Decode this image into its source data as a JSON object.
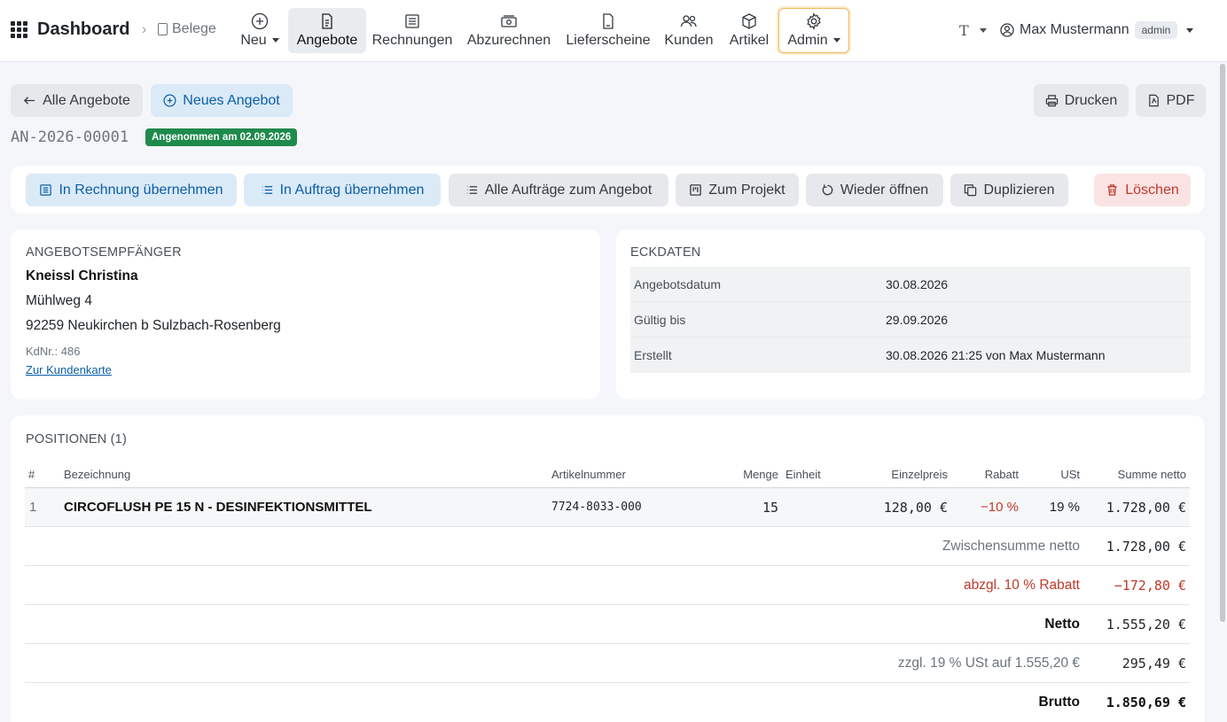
{
  "navbar": {
    "brand": "Dashboard",
    "breadcrumb": "Belege",
    "items": [
      {
        "label": "Neu",
        "icon": "plus-circle-icon"
      },
      {
        "label": "Angebote",
        "icon": "document-icon"
      },
      {
        "label": "Rechnungen",
        "icon": "receipt-icon"
      },
      {
        "label": "Abzurechnen",
        "icon": "cash-icon"
      },
      {
        "label": "Lieferscheine",
        "icon": "file-icon"
      },
      {
        "label": "Kunden",
        "icon": "people-icon"
      },
      {
        "label": "Artikel",
        "icon": "box-icon"
      },
      {
        "label": "Admin",
        "icon": "gear-icon"
      }
    ],
    "theme_label": "T",
    "user_name": "Max Mustermann",
    "user_role": "admin"
  },
  "toolbar": {
    "back_label": "Alle Angebote",
    "new_label": "Neues Angebot",
    "print_label": "Drucken",
    "pdf_label": "PDF"
  },
  "document": {
    "number": "AN-2026-00001",
    "status": "Angenommen am 02.09.2026"
  },
  "actions": {
    "to_invoice": "In Rechnung übernehmen",
    "to_order": "In Auftrag übernehmen",
    "all_orders": "Alle Aufträge zum Angebot",
    "to_project": "Zum Projekt",
    "reopen": "Wieder öffnen",
    "duplicate": "Duplizieren",
    "delete": "Löschen"
  },
  "recipient": {
    "title": "Angebotsempfänger",
    "name": "Kneissl Christina",
    "street": "Mühlweg 4",
    "city": "92259 Neukirchen b Sulzbach-Rosenberg",
    "customer_no": "KdNr.: 486",
    "link": "Zur Kundenkarte"
  },
  "key_data": {
    "title": "Eckdaten",
    "rows": [
      {
        "key": "Angebotsdatum",
        "value": "30.08.2026"
      },
      {
        "key": "Gültig bis",
        "value": "29.09.2026"
      },
      {
        "key": "Erstellt",
        "value": "30.08.2026 21:25 von Max Mustermann"
      }
    ]
  },
  "positions": {
    "title": "Positionen (1)",
    "headers": {
      "num": "#",
      "desc": "Bezeichnung",
      "sku": "Artikelnummer",
      "qty": "Menge",
      "unit": "Einheit",
      "price": "Einzelpreis",
      "discount": "Rabatt",
      "vat": "USt",
      "sum": "Summe netto"
    },
    "rows": [
      {
        "num": "1",
        "desc": "CIRCOFLUSH PE 15 N - DESINFEKTIONSMITTEL",
        "sku": "7724-8033-000",
        "qty": "15",
        "unit": "",
        "price": "128,00 €",
        "discount": "−10 %",
        "vat": "19 %",
        "sum": "1.728,00 €"
      }
    ],
    "totals": {
      "subtotal_label": "Zwischensumme netto",
      "subtotal_value": "1.728,00 €",
      "discount_label": "abzgl. 10 % Rabatt",
      "discount_value": "−172,80 €",
      "net_label": "Netto",
      "net_value": "1.555,20 €",
      "vat_label": "zzgl. 19 % USt auf 1.555,20 €",
      "vat_value": "295,49 €",
      "gross_label": "Brutto",
      "gross_value": "1.850,69 €"
    }
  }
}
